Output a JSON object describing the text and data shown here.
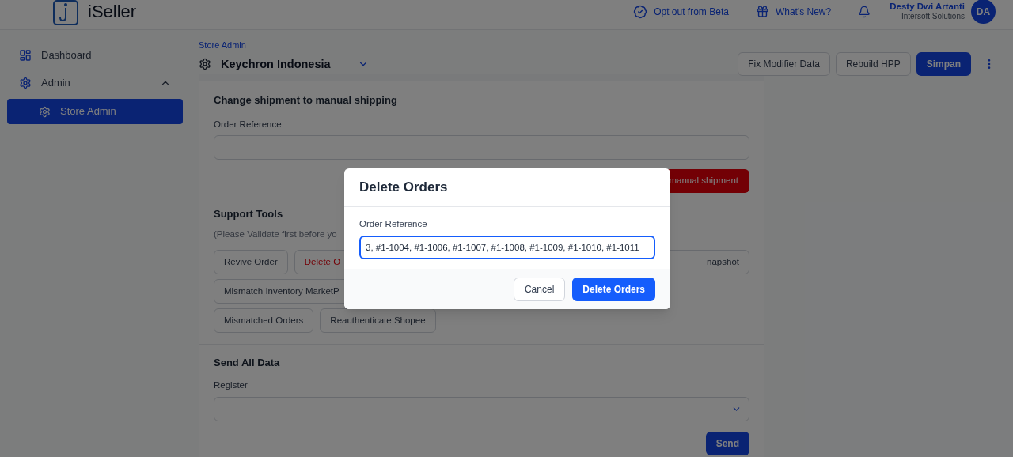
{
  "header": {
    "logo_text": "iSeller",
    "links": [
      {
        "label": "Opt out from Beta",
        "kind": "beta"
      },
      {
        "label": "What's New?",
        "kind": "gift"
      }
    ],
    "user": {
      "name": "Desty Dwi Artanti",
      "company": "Intersoft Solutions",
      "initials": "DA"
    }
  },
  "sidebar": {
    "items": [
      {
        "label": "Dashboard",
        "kind": "dashboard",
        "selected": false
      },
      {
        "label": "Admin",
        "kind": "gear",
        "selected": false,
        "expanded": true,
        "children": [
          {
            "label": "Store Admin",
            "kind": "gear",
            "selected": true
          }
        ]
      }
    ]
  },
  "page": {
    "breadcrumb": "Store Admin",
    "store": "Keychron Indonesia",
    "actions": [
      {
        "label": "Fix Modifier Data",
        "kind": "outline"
      },
      {
        "label": "Rebuild HPP",
        "kind": "outline"
      },
      {
        "label": "Simpan",
        "kind": "primary"
      }
    ]
  },
  "sections": [
    {
      "kind": "shipment",
      "title": "Change shipment to manual shipping",
      "field_label": "Order Reference",
      "button": "manual shipment"
    },
    {
      "kind": "tools",
      "title": "Support Tools",
      "note": "(Please Validate first before yo",
      "rows": [
        [
          {
            "label": "Revive Order",
            "kind": "normal"
          },
          {
            "label": "Delete O",
            "kind": "danger-cut"
          },
          {
            "label": "napshot",
            "kind": "cut-left"
          }
        ],
        [
          {
            "label": "Mismatch Inventory MarketP",
            "kind": "cut"
          }
        ],
        [
          {
            "label": "Mismatched Orders",
            "kind": "normal"
          },
          {
            "label": "Reauthenticate Shopee",
            "kind": "normal"
          }
        ]
      ]
    },
    {
      "kind": "send",
      "title": "Send All Data",
      "field_label": "Register",
      "button": "Send"
    }
  ],
  "dialog": {
    "title": "Delete Orders",
    "field_label": "Order Reference",
    "value": "3, #1-1004, #1-1006, #1-1007, #1-1008, #1-1009, #1-1010, #1-1011",
    "buttons": [
      {
        "label": "Cancel",
        "kind": "secondary"
      },
      {
        "label": "Delete Orders",
        "kind": "primary"
      }
    ]
  }
}
